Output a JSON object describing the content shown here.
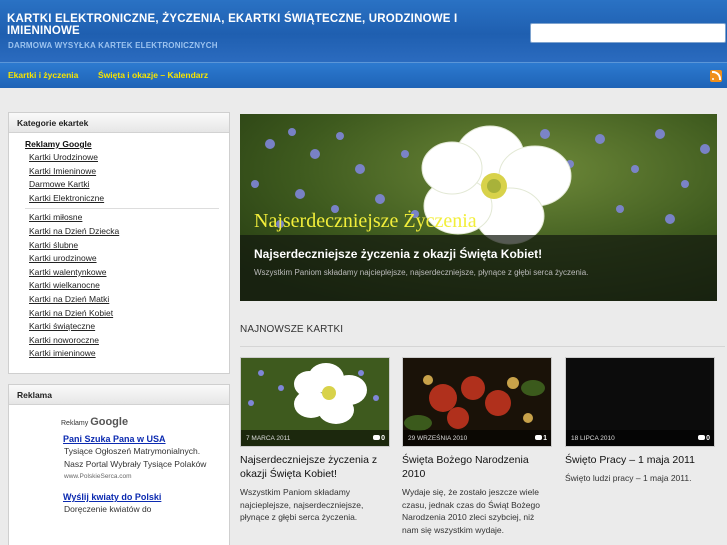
{
  "header": {
    "title": "KARTKI ELEKTRONICZNE, ŻYCZENIA, EKARTKI ŚWIĄTECZNE, URODZINOWE I IMIENINOWE",
    "subtitle": "DARMOWA WYSYŁKA KARTEK ELEKTRONICZNYCH",
    "search_value": ""
  },
  "nav": {
    "items": [
      "Ekartki i życzenia",
      "Święta i okazje – Kalendarz"
    ],
    "rss_icon": "rss-icon"
  },
  "sidebar": {
    "categories": {
      "title": "Kategorie ekartek",
      "ads_title": "Reklamy Google",
      "ad_links": [
        "Kartki Urodzinowe",
        "Kartki Imieninowe",
        "Darmowe Kartki",
        "Kartki Elektroniczne"
      ],
      "items": [
        "Kartki miłosne",
        "Kartki na Dzień Dziecka",
        "Kartki ślubne",
        "Kartki urodzinowe",
        "Kartki walentynkowe",
        "Kartki wielkanocne",
        "Kartki na Dzień Matki",
        "Kartki na Dzień Kobiet",
        "Kartki świąteczne",
        "Kartki noworoczne",
        "Kartki imieninowe"
      ]
    },
    "ads": {
      "title": "Reklama",
      "ads_by": "Reklamy",
      "google": "Google",
      "entries": [
        {
          "link": "Pani Szuka Pana w USA",
          "text": "Tysiące Ogłoszeń Matrymonialnych. Nasz Portal Wybrały Tysiące Polaków",
          "url": "www.PolskieSerca.com"
        },
        {
          "link": "Wyślij kwiaty do Polski",
          "text": "Doręczenie kwiatów do",
          "url": ""
        }
      ]
    }
  },
  "slider": {
    "title": "Najserdeczniejsze życzenia z okazji Święta Kobiet!",
    "description": "Wszystkim Paniom składamy najcieplejsze, najserdeczniejsze, płynące z głębi serca życzenia.",
    "image_text": "Najserdeczniejsze Życzenia"
  },
  "latest": {
    "title": "NAJNOWSZE KARTKI",
    "cards": [
      {
        "date": "7 marca 2011",
        "comments": "0",
        "title": "Najserdeczniejsze życzenia z okazji Święta Kobiet!",
        "text": "Wszystkim Paniom składamy najcieplejsze, najserdeczniejsze, płynące z głębi serca życzenia."
      },
      {
        "date": "29 września 2010",
        "comments": "1",
        "title": "Święta Bożego Narodzenia 2010",
        "text": "Wydaje się, że zostało jeszcze wiele czasu, jednak czas do Świąt Bożego Narodzenia 2010 zleci szybciej, niż nam się wszystkim wydaje."
      },
      {
        "date": "18 lipca 2010",
        "comments": "0",
        "title": "Święto Pracy – 1 maja 2011",
        "text": "Święto ludzi pracy – 1 maja 2011."
      }
    ]
  }
}
